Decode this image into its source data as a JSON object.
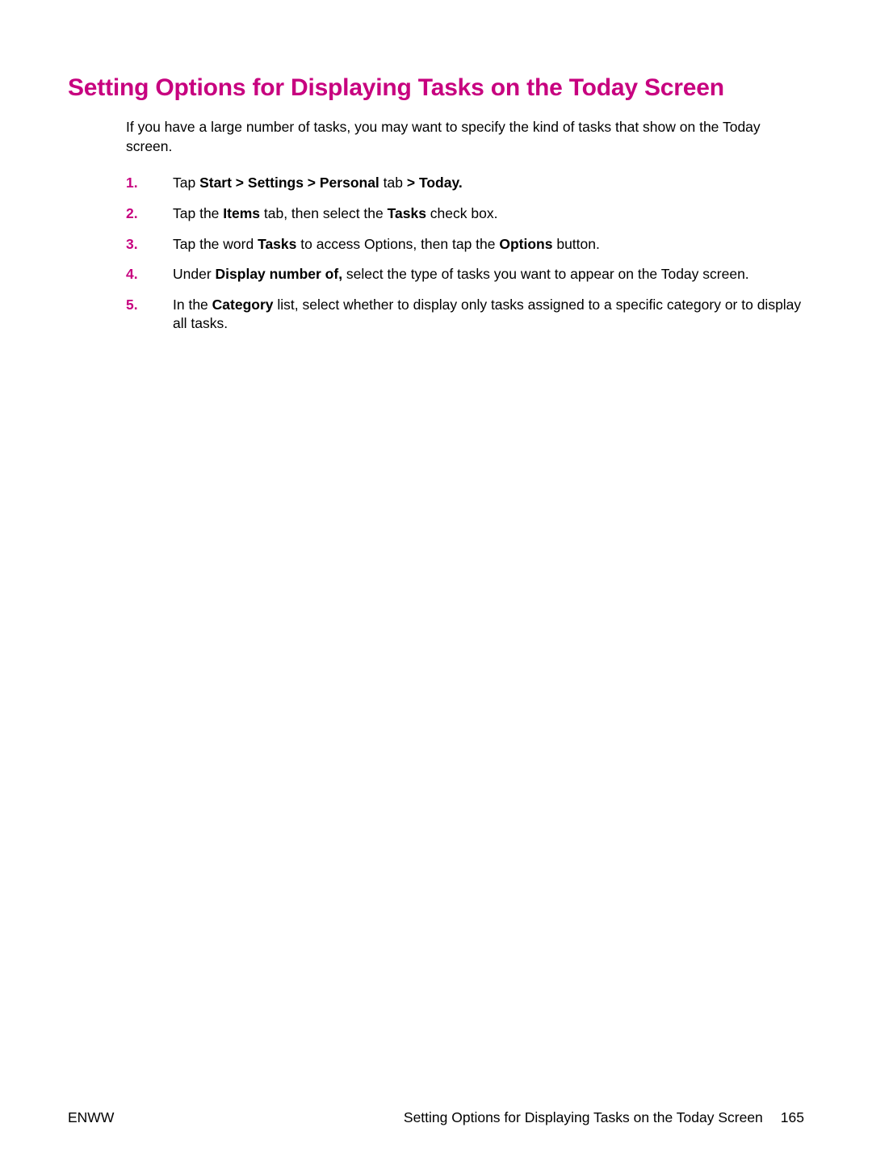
{
  "heading": "Setting Options for Displaying Tasks on the Today Screen",
  "intro": "If you have a large number of tasks, you may want to specify the kind of tasks that show on the Today screen.",
  "steps": [
    {
      "num": "1.",
      "segments": [
        {
          "text": "Tap ",
          "bold": false
        },
        {
          "text": "Start > Settings > Personal",
          "bold": true
        },
        {
          "text": " tab ",
          "bold": false
        },
        {
          "text": "> Today.",
          "bold": true
        }
      ]
    },
    {
      "num": "2.",
      "segments": [
        {
          "text": "Tap the ",
          "bold": false
        },
        {
          "text": "Items",
          "bold": true
        },
        {
          "text": " tab, then select the ",
          "bold": false
        },
        {
          "text": "Tasks",
          "bold": true
        },
        {
          "text": " check box.",
          "bold": false
        }
      ]
    },
    {
      "num": "3.",
      "segments": [
        {
          "text": "Tap the word ",
          "bold": false
        },
        {
          "text": "Tasks",
          "bold": true
        },
        {
          "text": " to access Options, then tap the ",
          "bold": false
        },
        {
          "text": "Options",
          "bold": true
        },
        {
          "text": " button.",
          "bold": false
        }
      ]
    },
    {
      "num": "4.",
      "segments": [
        {
          "text": "Under ",
          "bold": false
        },
        {
          "text": "Display number of,",
          "bold": true
        },
        {
          "text": " select the type of tasks you want to appear on the Today screen.",
          "bold": false
        }
      ]
    },
    {
      "num": "5.",
      "segments": [
        {
          "text": "In the ",
          "bold": false
        },
        {
          "text": "Category",
          "bold": true
        },
        {
          "text": " list, select whether to display only tasks assigned to a specific category or to display all tasks.",
          "bold": false
        }
      ]
    }
  ],
  "footer": {
    "left": "ENWW",
    "rightTitle": "Setting Options for Displaying Tasks on the Today Screen",
    "pageNum": "165"
  }
}
